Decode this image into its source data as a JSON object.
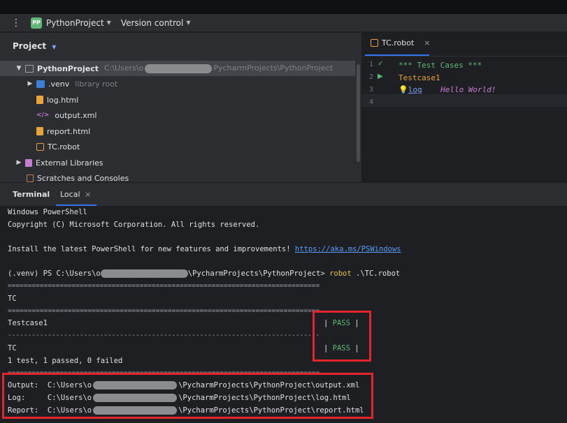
{
  "titlebar": {
    "badge": "PP",
    "project": "PythonProject",
    "vcs": "Version control"
  },
  "project_panel": {
    "title": "Project",
    "root": {
      "name": "PythonProject",
      "path_prefix": "C:\\Users\\o",
      "path_suffix": "PycharmProjects\\PythonProject"
    },
    "items": [
      {
        "name": ".venv",
        "hint": "library root"
      },
      {
        "name": "log.html"
      },
      {
        "name": "output.xml"
      },
      {
        "name": "report.html"
      },
      {
        "name": "TC.robot"
      },
      {
        "name": "External Libraries"
      },
      {
        "name": "Scratches and Consoles"
      }
    ]
  },
  "editor": {
    "tab": "TC.robot",
    "line_numbers": [
      "1",
      "2",
      "3",
      "4"
    ],
    "lines": {
      "header": "*** Test Cases ***",
      "testcase": "Testcase1",
      "keyword": "log",
      "arg": "Hello World!"
    }
  },
  "terminal": {
    "tab_title": "Terminal",
    "tab_local": "Local",
    "lines": {
      "l1": "Windows PowerShell",
      "l2": "Copyright (C) Microsoft Corporation. All rights reserved.",
      "l3": "Install the latest PowerShell for new features and improvements! ",
      "link": "https://aka.ms/PSWindows",
      "prompt_prefix": "(.venv) PS C:\\Users\\o",
      "prompt_suffix": "\\PycharmProjects\\PythonProject> ",
      "cmd": "robot",
      "cmd_arg": " .\\TC.robot",
      "sep_eq": "==============================================================================",
      "suite_name": "TC",
      "sep_eq2": "==============================================================================",
      "testcase": "Testcase1",
      "pass_left": "| ",
      "pass": "PASS",
      "pass_right": " |",
      "sep_dash": "------------------------------------------------------------------------------",
      "suite2": "TC",
      "pass2_left": "| ",
      "pass2": "PASS",
      "pass2_right": " |",
      "summary": "1 test, 1 passed, 0 failed",
      "sep_eq3": "==============================================================================",
      "output_label": "Output:  C:\\Users\\o",
      "output_suffix": "\\PycharmProjects\\PythonProject\\output.xml",
      "log_label": "Log:     C:\\Users\\o",
      "log_suffix": "\\PycharmProjects\\PythonProject\\log.html",
      "report_label": "Report:  C:\\Users\\o",
      "report_suffix": "\\PycharmProjects\\PythonProject\\report.html"
    }
  },
  "colors": {
    "pass": "#5fb878",
    "highlight_box": "#e3252b",
    "accent": "#3574f0",
    "command": "#e3c54b"
  }
}
